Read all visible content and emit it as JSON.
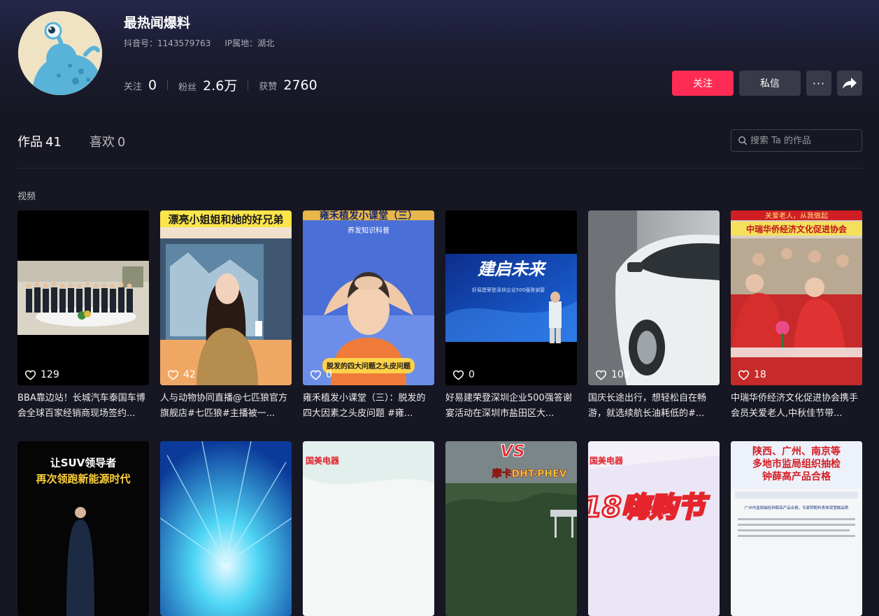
{
  "profile": {
    "name": "最热闻爆料",
    "douyin_id": "抖音号：1143579763",
    "ip_location": "IP属地：湖北",
    "stats": [
      {
        "label": "关注",
        "value": "0"
      },
      {
        "label": "粉丝",
        "value": "2.6万"
      },
      {
        "label": "获赞",
        "value": "2760"
      }
    ]
  },
  "actions": {
    "follow_label": "关注",
    "message_label": "私信",
    "more_label": "···"
  },
  "tabs": [
    {
      "label": "作品",
      "count": "41",
      "active": true
    },
    {
      "label": "喜欢",
      "count": "0",
      "active": false
    }
  ],
  "search": {
    "placeholder": "搜索 Ta 的作品"
  },
  "section_label": "视频",
  "videos": [
    {
      "likes": "129",
      "title": "BBA靠边站！长城汽车泰国车博会全球百家经销商现场签约..."
    },
    {
      "likes": "42",
      "title": "人与动物协同直播@七匹狼官方旗舰店#七匹狼#主播被一..."
    },
    {
      "likes": "0",
      "title": "雍禾植发小课堂（三）：脱发的四大因素之头皮问题 #雍..."
    },
    {
      "likes": "0",
      "title": "好易建荣登深圳企业500强答谢宴活动在深圳市盐田区大..."
    },
    {
      "likes": "109",
      "title": "国庆长途出行，想轻松自在畅游，就选续航长油耗低的#..."
    },
    {
      "likes": "18",
      "title": "中瑞华侨经济文化促进协会携手会员关爱老人,中秋佳节带..."
    }
  ],
  "thumb_text": {
    "v2_caption": "漂亮小姐姐和她的好兄弟",
    "v3_heading": "雍禾植发小课堂（三）",
    "v3_sub": "养发知识科普",
    "v3_banner": "脱发的四大问题之头皮问题",
    "v4_title": "建启未来",
    "v4_sub": "好易建荣登深圳企业500强答谢宴",
    "v6_top": "关爱老人，从我做起",
    "v6_banner": "中瑞华侨经济文化促进协会",
    "r2a_line1": "让SUV领导者",
    "r2a_line2": "再次领跑新能源时代",
    "r2c_brand": "国美电器",
    "r2d_vs": "VS",
    "r2d_model": "摩卡DHT-PHEV",
    "r2e_brand": "国美电器",
    "r2e_sale": "18嗨购节",
    "r2f_line1": "陕西、广州、南京等",
    "r2f_line2": "多地市监局组织抽检",
    "r2f_line3": "钟薛高产品合格",
    "r2f_doc": "广州市监局抽检钟薛高产品合格，专家称配料表体现雪糕品质"
  },
  "colors": {
    "accent": "#fe2c55",
    "button": "#393a48",
    "background": "#161722"
  }
}
